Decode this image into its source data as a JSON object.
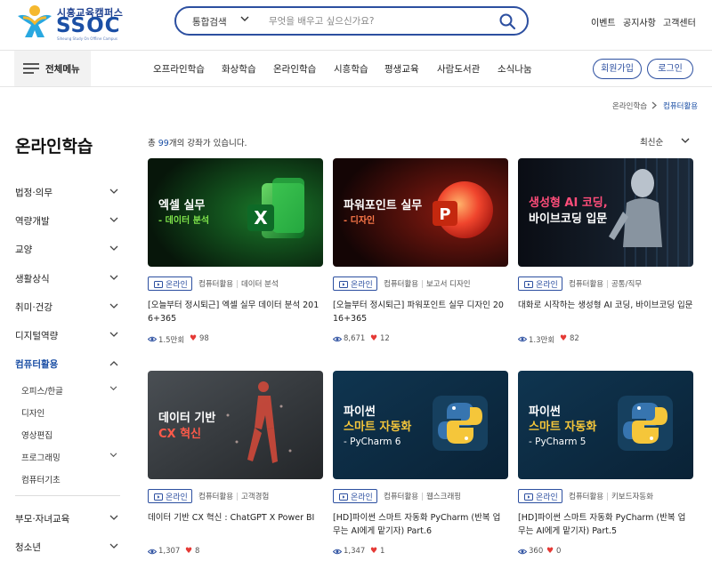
{
  "brand": {
    "name_ko": "시흥교육캠퍼스",
    "name": "SSOC",
    "tagline": "Siheung Study On Offline Campus"
  },
  "search": {
    "category": "통합검색",
    "placeholder": "무엇을 배우고 싶으신가요?"
  },
  "util_links": [
    "이벤트",
    "공지사항",
    "고객센터"
  ],
  "nav": {
    "all_menu": "전체메뉴",
    "links": [
      "오프라인학습",
      "화상학습",
      "온라인학습",
      "시흥학습",
      "평생교육",
      "사람도서관",
      "소식나눔"
    ],
    "signup": "회원가입",
    "login": "로그인"
  },
  "breadcrumb": [
    "온라인학습",
    "컴퓨터활용"
  ],
  "sidebar": {
    "title": "온라인학습",
    "items": [
      {
        "label": "법정·의무"
      },
      {
        "label": "역량개발"
      },
      {
        "label": "교양"
      },
      {
        "label": "생활상식"
      },
      {
        "label": "취미·건강"
      },
      {
        "label": "디지털역량"
      },
      {
        "label": "컴퓨터활용"
      },
      {
        "label": "부모·자녀교육"
      },
      {
        "label": "청소년"
      }
    ],
    "subitems": [
      {
        "label": "오피스/한글"
      },
      {
        "label": "디자인"
      },
      {
        "label": "영상편집"
      },
      {
        "label": "프로그래밍"
      },
      {
        "label": "컴퓨터기초"
      }
    ]
  },
  "listing": {
    "count_prefix": "총 ",
    "count": "99",
    "count_suffix": "개의 강좌가 있습니다.",
    "sort": "최신순"
  },
  "courses": [
    {
      "thumb_title": "엑셀 실무",
      "thumb_sub": "- 데이터 분석",
      "badge": "온라인",
      "category": "컴퓨터활용",
      "subcategory": "데이터 분석",
      "title": "[오늘부터 정시퇴근] 엑셀 실무 데이터 분석 2016+365",
      "views": "1.5만회",
      "likes": "98"
    },
    {
      "thumb_title": "파워포인트 실무",
      "thumb_sub": "- 디자인",
      "badge": "온라인",
      "category": "컴퓨터활용",
      "subcategory": "보고서 디자인",
      "title": "[오늘부터 정시퇴근] 파워포인트 실무 디자인 2016+365",
      "views": "8,671",
      "likes": "12"
    },
    {
      "thumb_title": "생성형 AI 코딩,",
      "thumb_sub": "바이브코딩 입문",
      "badge": "온라인",
      "category": "컴퓨터활용",
      "subcategory": "공통/직무",
      "title": "대화로 시작하는 생성형 AI 코딩, 바이브코딩 입문",
      "views": "1.3만회",
      "likes": "82"
    },
    {
      "thumb_title": "데이터 기반",
      "thumb_sub": "CX 혁신",
      "badge": "온라인",
      "category": "컴퓨터활용",
      "subcategory": "고객경험",
      "title": "데이터 기반 CX 혁신 : ChatGPT X Power BI",
      "views": "1,307",
      "likes": "8"
    },
    {
      "thumb_title": "파이썬",
      "thumb_title2": "스마트 자동화",
      "thumb_sub": "- PyCharm 6",
      "badge": "온라인",
      "category": "컴퓨터활용",
      "subcategory": "웹스크래핑",
      "title": "[HD]파이썬 스마트 자동화 PyCharm (반복 업무는 AI에게 맡기자) Part.6",
      "views": "1,347",
      "likes": "1"
    },
    {
      "thumb_title": "파이썬",
      "thumb_title2": "스마트 자동화",
      "thumb_sub": "- PyCharm 5",
      "badge": "온라인",
      "category": "컴퓨터활용",
      "subcategory": "키보드자동화",
      "title": "[HD]파이썬 스마트 자동화 PyCharm (반복 업무는 AI에게 맡기자) Part.5",
      "views": "360",
      "likes": "0"
    }
  ],
  "colors": {
    "brand_blue": "#1b4fa5",
    "accent_yellow": "#f5b82e",
    "accent_cyan": "#29a8e0",
    "heart_red": "#e53935"
  }
}
